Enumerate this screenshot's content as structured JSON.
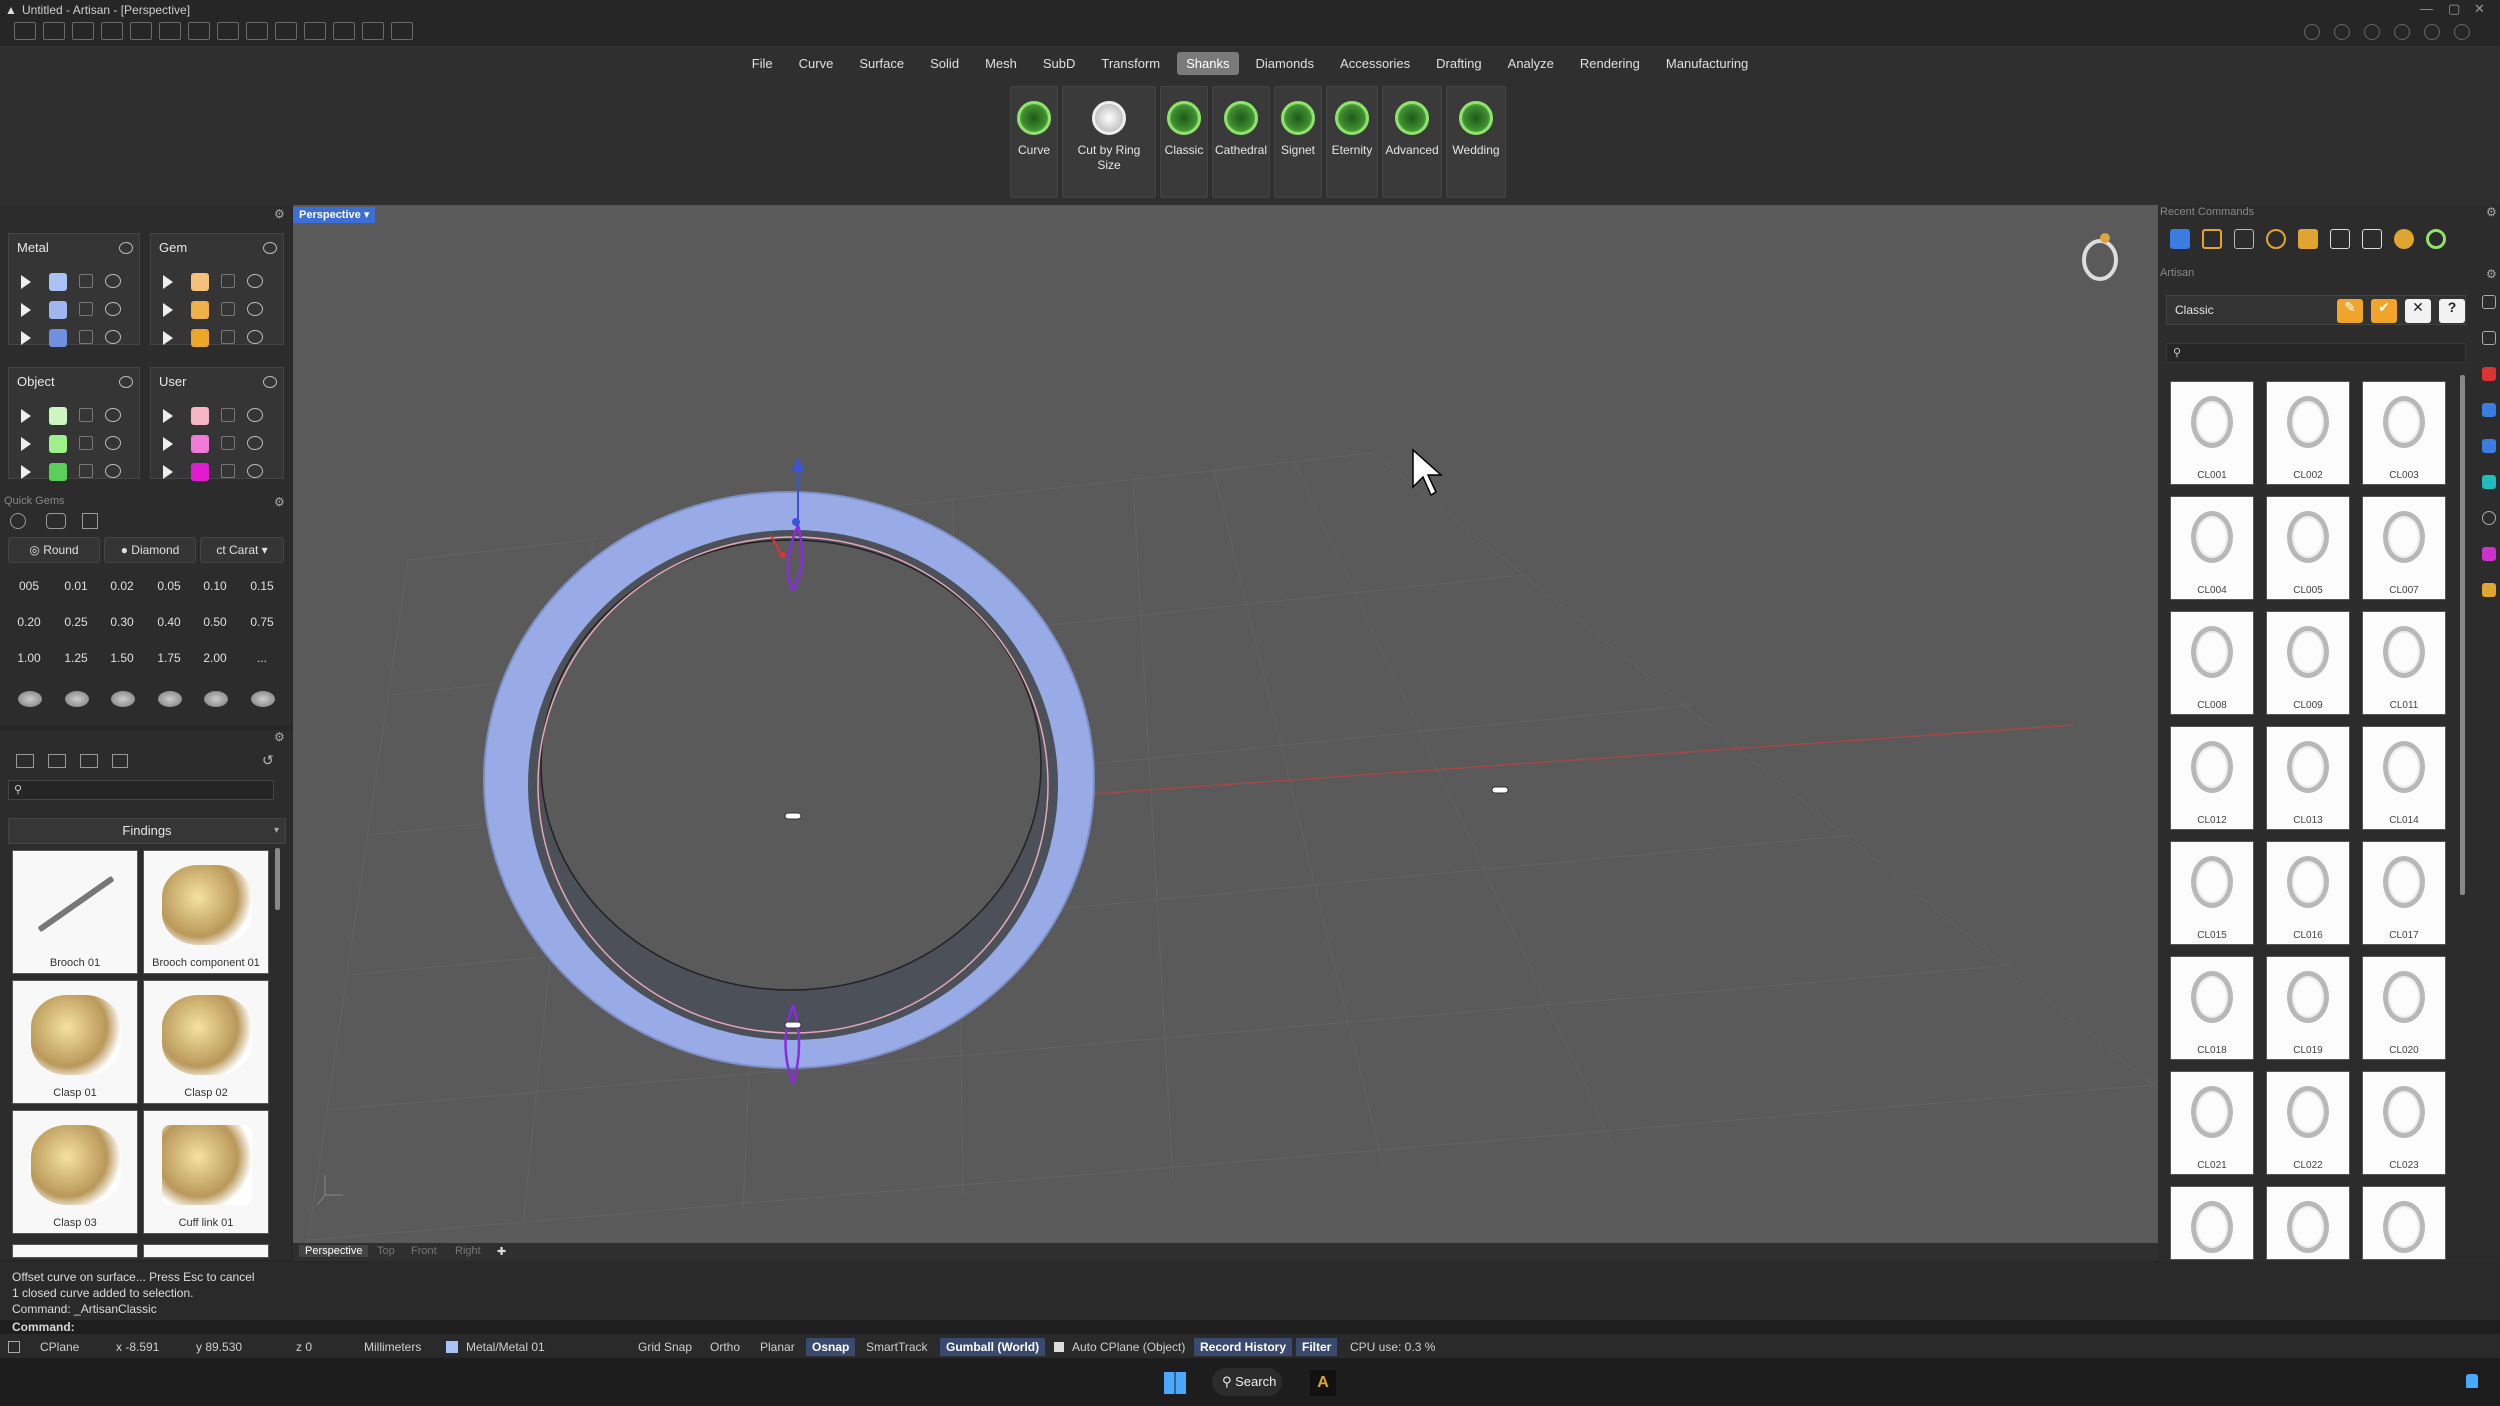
{
  "title": "Untitled - Artisan - [Perspective]",
  "ribbon": {
    "tabs": [
      "File",
      "Curve",
      "Surface",
      "Solid",
      "Mesh",
      "SubD",
      "Transform",
      "Shanks",
      "Diamonds",
      "Accessories",
      "Drafting",
      "Analyze",
      "Rendering",
      "Manufacturing"
    ],
    "active_tab": "Shanks",
    "tools": [
      {
        "label": "Curve"
      },
      {
        "label": "Cut by Ring Size"
      },
      {
        "label": "Classic"
      },
      {
        "label": "Cathedral"
      },
      {
        "label": "Signet"
      },
      {
        "label": "Eternity"
      },
      {
        "label": "Advanced"
      },
      {
        "label": "Wedding"
      }
    ]
  },
  "layers": {
    "metal": {
      "name": "Metal",
      "colors": [
        "#a9c2f5",
        "#9fb7ee",
        "#6f8fe0"
      ]
    },
    "gem": {
      "name": "Gem",
      "colors": [
        "#f4c07a",
        "#f2b04a",
        "#eea62a"
      ]
    },
    "object": {
      "name": "Object",
      "colors": [
        "#cdf5c2",
        "#9ef08a",
        "#5ccf5a"
      ]
    },
    "user": {
      "name": "User",
      "colors": [
        "#f6b6c6",
        "#f07ad8",
        "#e21ad0"
      ]
    }
  },
  "quick_gems": {
    "title": "Quick Gems",
    "shape": "Round",
    "material": "Diamond",
    "unit": "Carat",
    "sizes": [
      "005",
      "0.01",
      "0.02",
      "0.05",
      "0.10",
      "0.15",
      "0.20",
      "0.25",
      "0.30",
      "0.40",
      "0.50",
      "0.75",
      "1.00",
      "1.25",
      "1.50",
      "1.75",
      "2.00",
      "..."
    ]
  },
  "library": {
    "category": "Findings",
    "items": [
      "Brooch 01",
      "Brooch component 01",
      "Clasp 01",
      "Clasp 02",
      "Clasp 03",
      "Cuff link 01"
    ]
  },
  "viewport": {
    "name": "Perspective",
    "tabs": [
      "Perspective",
      "Top",
      "Front",
      "Right"
    ]
  },
  "right_panel": {
    "recent_label": "Recent Commands",
    "artisan_label": "Artisan",
    "preset": "Classic",
    "items": [
      "CL001",
      "CL002",
      "CL003",
      "CL004",
      "CL005",
      "CL007",
      "CL008",
      "CL009",
      "CL011",
      "CL012",
      "CL013",
      "CL014",
      "CL015",
      "CL016",
      "CL017",
      "CL018",
      "CL019",
      "CL020",
      "CL021",
      "CL022",
      "CL023",
      "",
      "",
      ""
    ]
  },
  "command_history": [
    "Offset curve on surface... Press Esc to cancel",
    "1 closed curve added to selection.",
    "Command: _ArtisanClassic"
  ],
  "command_prompt": "Command:",
  "status": {
    "cplane": "CPlane",
    "x": "x -8.591",
    "y": "y 89.530",
    "z": "z 0",
    "units": "Millimeters",
    "layer": "Metal/Metal 01",
    "grid_snap": "Grid Snap",
    "ortho": "Ortho",
    "planar": "Planar",
    "osnap": "Osnap",
    "smarttrack": "SmartTrack",
    "gumball": "Gumball (World)",
    "auto_cplane": "Auto CPlane (Object)",
    "record_history": "Record History",
    "filter": "Filter",
    "cpu": "CPU use: 0.3 %"
  },
  "taskbar": {
    "search": "Search"
  }
}
